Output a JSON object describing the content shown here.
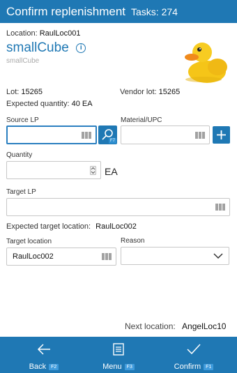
{
  "header": {
    "title": "Confirm replenishment",
    "tasks": "Tasks: 274"
  },
  "location": {
    "label": "Location:",
    "value": "RaulLoc001"
  },
  "product": {
    "name": "smallCube",
    "sub": "smallCube"
  },
  "lot": {
    "label": "Lot:",
    "value": "15265"
  },
  "vendor_lot": {
    "label": "Vendor lot:",
    "value": "15265"
  },
  "expected_qty": {
    "label": "Expected quantity:",
    "value": "40 EA"
  },
  "source_lp": {
    "label": "Source LP",
    "value": "",
    "key": "F7"
  },
  "material": {
    "label": "Material/UPC",
    "value": ""
  },
  "quantity": {
    "label": "Quantity",
    "value": "",
    "unit": "EA"
  },
  "target_lp": {
    "label": "Target LP",
    "value": ""
  },
  "expected_target": {
    "label": "Expected target location:",
    "value": "RaulLoc002"
  },
  "target_location": {
    "label": "Target location",
    "value": "RaulLoc002"
  },
  "reason": {
    "label": "Reason",
    "value": ""
  },
  "next_location": {
    "label": "Next location:",
    "value": "AngelLoc10"
  },
  "footer": {
    "back": {
      "label": "Back",
      "key": "F2"
    },
    "menu": {
      "label": "Menu",
      "key": "F3"
    },
    "confirm": {
      "label": "Confirm",
      "key": "F1"
    }
  },
  "colors": {
    "accent": "#1f78b4",
    "duck": "#f5c518"
  }
}
